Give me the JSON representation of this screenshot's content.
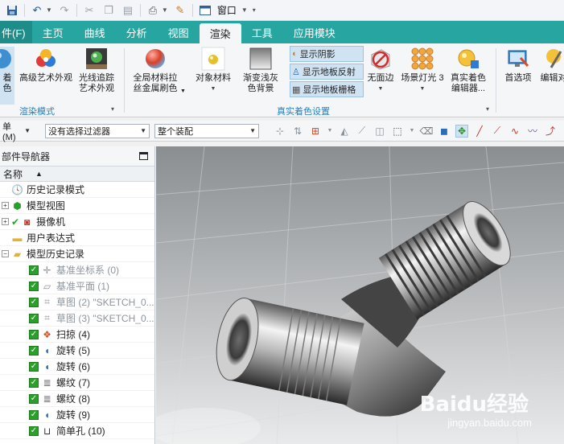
{
  "quick_access": {
    "window_menu_label": "窗口"
  },
  "tabs": [
    {
      "label": "件(F)"
    },
    {
      "label": "主页"
    },
    {
      "label": "曲线"
    },
    {
      "label": "分析"
    },
    {
      "label": "视图"
    },
    {
      "label": "渲染"
    },
    {
      "label": "工具"
    },
    {
      "label": "应用模块"
    }
  ],
  "active_tab": "渲染",
  "ribbon": {
    "buttons": {
      "shading_cut": "着色",
      "advanced_art": "高级艺术外观",
      "raytrace_line1": "光线追踪",
      "raytrace_line2": "艺术外观",
      "global_material_line1": "全局材料拉",
      "global_material_line2": "丝金属刷色",
      "object_material": "对象材料",
      "gradient_line1": "渐变浅灰",
      "gradient_line2": "色背景",
      "show_shadow": "显示阴影",
      "show_floor_reflection": "显示地板反射",
      "show_floor_grid": "显示地板栅格",
      "no_edge": "无面边",
      "scene_light": "场景灯光 3",
      "true_shading_line1": "真实着色",
      "true_shading_line2": "编辑器...",
      "preferences": "首选项",
      "edit_cut": "编辑对"
    },
    "groups": {
      "render_mode": "渲染模式",
      "true_shading_settings": "真实着色设置"
    }
  },
  "filterbar": {
    "menu_cut": "单(M)",
    "selection_filter": "没有选择过滤器",
    "assembly_scope": "整个装配"
  },
  "navigator": {
    "title": "部件导航器",
    "column_name": "名称",
    "items": [
      {
        "label": "历史记录模式",
        "icon": "clock-icon",
        "greyed": false
      },
      {
        "label": "模型视图",
        "icon": "model-view-icon",
        "greyed": false
      },
      {
        "label": "摄像机",
        "icon": "camera-icon",
        "greyed": false
      },
      {
        "label": "用户表达式",
        "icon": "folder-icon",
        "greyed": false
      },
      {
        "label": "模型历史记录",
        "icon": "folder-open-icon",
        "greyed": false
      },
      {
        "label": "基准坐标系 (0)",
        "icon": "datum-csys-icon",
        "greyed": true
      },
      {
        "label": "基准平面 (1)",
        "icon": "datum-plane-icon",
        "greyed": true
      },
      {
        "label": "草图 (2) \"SKETCH_0...",
        "icon": "sketch-icon",
        "greyed": true
      },
      {
        "label": "草图 (3) \"SKETCH_0...",
        "icon": "sketch-icon",
        "greyed": true
      },
      {
        "label": "扫掠 (4)",
        "icon": "sweep-icon",
        "greyed": false
      },
      {
        "label": "旋转 (5)",
        "icon": "revolve-icon",
        "greyed": false
      },
      {
        "label": "旋转 (6)",
        "icon": "revolve-icon",
        "greyed": false
      },
      {
        "label": "螺纹 (7)",
        "icon": "thread-icon",
        "greyed": false
      },
      {
        "label": "螺纹 (8)",
        "icon": "thread-icon",
        "greyed": false
      },
      {
        "label": "旋转 (9)",
        "icon": "revolve-icon",
        "greyed": false
      },
      {
        "label": "简单孔 (10)",
        "icon": "hole-icon",
        "greyed": false
      }
    ]
  },
  "watermark": {
    "brand": "Baidu经验",
    "url": "jingyan.baidu.com"
  },
  "colors": {
    "tab_bar": "#27a5a1",
    "group_label": "#2a7db7",
    "check_green": "#2aa02a"
  }
}
